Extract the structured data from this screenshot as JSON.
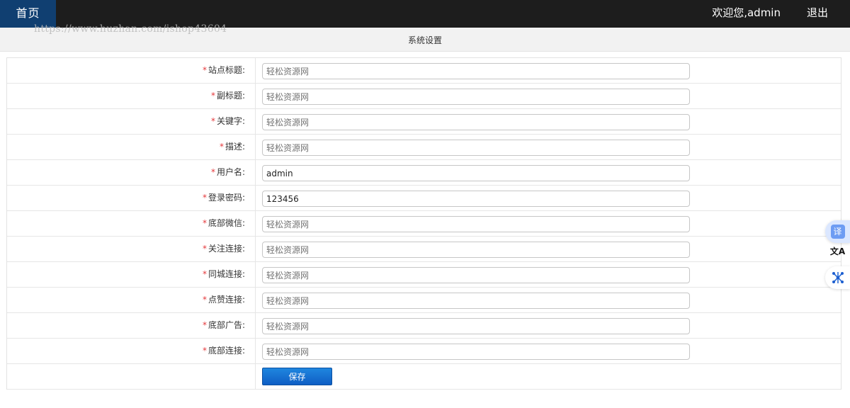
{
  "header": {
    "home_label": "首页",
    "welcome_text": "欢迎您,admin",
    "logout_label": "退出",
    "watermark": "https://www.huzhan.com/ishop43604"
  },
  "page": {
    "title": "系统设置"
  },
  "form": {
    "required_mark": "*",
    "fields": [
      {
        "label": "站点标题:",
        "placeholder": "轻松资源网",
        "value": ""
      },
      {
        "label": "副标题:",
        "placeholder": "轻松资源网",
        "value": ""
      },
      {
        "label": "关键字:",
        "placeholder": "轻松资源网",
        "value": ""
      },
      {
        "label": "描述:",
        "placeholder": "轻松资源网",
        "value": ""
      },
      {
        "label": "用户名:",
        "placeholder": "",
        "value": "admin"
      },
      {
        "label": "登录密码:",
        "placeholder": "",
        "value": "123456"
      },
      {
        "label": "底部微信:",
        "placeholder": "轻松资源网",
        "value": ""
      },
      {
        "label": "关注连接:",
        "placeholder": "轻松资源网",
        "value": ""
      },
      {
        "label": "同城连接:",
        "placeholder": "轻松资源网",
        "value": ""
      },
      {
        "label": "点赞连接:",
        "placeholder": "轻松资源网",
        "value": ""
      },
      {
        "label": "底部广告:",
        "placeholder": "轻松资源网",
        "value": ""
      },
      {
        "label": "底部连接:",
        "placeholder": "轻松资源网",
        "value": ""
      }
    ],
    "save_label": "保存"
  },
  "side_tools": {
    "translate_label": "译",
    "translate_glyph": "文A"
  },
  "colors": {
    "topbar": "#1d1d1d",
    "home_tab": "#103f71",
    "required": "#e4393c",
    "save_button": "#0f5ec4"
  }
}
